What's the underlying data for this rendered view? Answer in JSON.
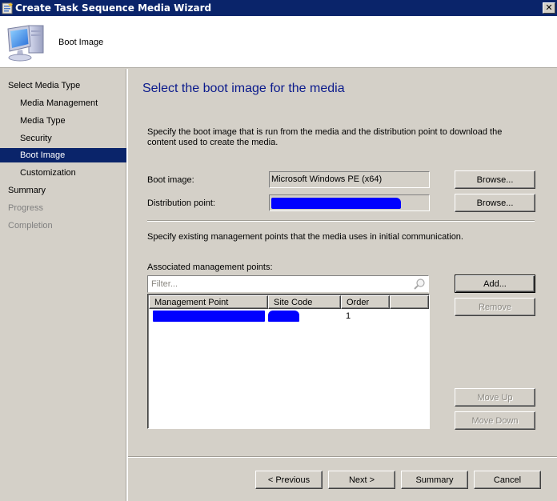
{
  "window": {
    "title": "Create Task Sequence Media Wizard",
    "close_label": "✕"
  },
  "header": {
    "title": "Boot Image",
    "icon": "computer-icon"
  },
  "sidebar": {
    "items": [
      {
        "label": "Select Media Type",
        "level": "top",
        "state": "normal"
      },
      {
        "label": "Media Management",
        "level": "sub",
        "state": "normal"
      },
      {
        "label": "Media Type",
        "level": "sub",
        "state": "normal"
      },
      {
        "label": "Security",
        "level": "sub",
        "state": "normal"
      },
      {
        "label": "Boot Image",
        "level": "sub",
        "state": "active"
      },
      {
        "label": "Customization",
        "level": "sub",
        "state": "normal"
      },
      {
        "label": "Summary",
        "level": "top",
        "state": "normal"
      },
      {
        "label": "Progress",
        "level": "top",
        "state": "disabled"
      },
      {
        "label": "Completion",
        "level": "top",
        "state": "disabled"
      }
    ]
  },
  "main": {
    "page_title": "Select the boot image for the media",
    "description": "Specify the boot image that is run from the media and the distribution point to download the content used to create the media.",
    "boot_image": {
      "label": "Boot image:",
      "value": "Microsoft Windows PE (x64)",
      "browse_label": "Browse..."
    },
    "distribution_point": {
      "label": "Distribution point:",
      "value": "[redacted]",
      "browse_label": "Browse..."
    },
    "mp_description": "Specify existing management points that the media uses in initial communication.",
    "associated_mp_label": "Associated management points:",
    "filter": {
      "placeholder": "Filter...",
      "icon": "search-icon"
    },
    "table": {
      "columns": [
        "Management Point",
        "Site Code",
        "Order"
      ],
      "rows": [
        {
          "management_point": "[redacted]",
          "site_code": "[redacted]",
          "order": "1"
        }
      ]
    },
    "side_buttons": {
      "add": "Add...",
      "remove": "Remove",
      "move_up": "Move Up",
      "move_down": "Move Down"
    }
  },
  "footer": {
    "previous": "< Previous",
    "next": "Next >",
    "summary": "Summary",
    "cancel": "Cancel"
  },
  "colors": {
    "titlebar": "#0a246a",
    "selection": "#0a246a",
    "page_title": "#0a1a8c",
    "redaction": "#0000ff",
    "dialog_bg": "#d4d0c8"
  }
}
